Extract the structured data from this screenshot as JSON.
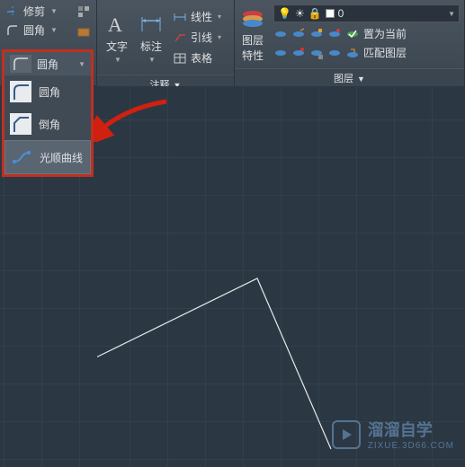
{
  "modify": {
    "trim_label": "修剪",
    "fillet_label": "圆角"
  },
  "annotation": {
    "text_label": "文字",
    "dim_label": "标注",
    "linear_label": "线性",
    "leader_label": "引线",
    "table_label": "表格",
    "panel_title": "注释"
  },
  "layers": {
    "properties_label": "图层\n特性",
    "set_current": "置为当前",
    "match_layer": "匹配图层",
    "combo_value": "0",
    "panel_title": "图层"
  },
  "flyout": {
    "fillet": "圆角",
    "chamfer": "倒角",
    "blend": "光顺曲线"
  },
  "watermark": {
    "title": "溜溜自学",
    "sub": "ZIXUE.3D66.COM"
  }
}
